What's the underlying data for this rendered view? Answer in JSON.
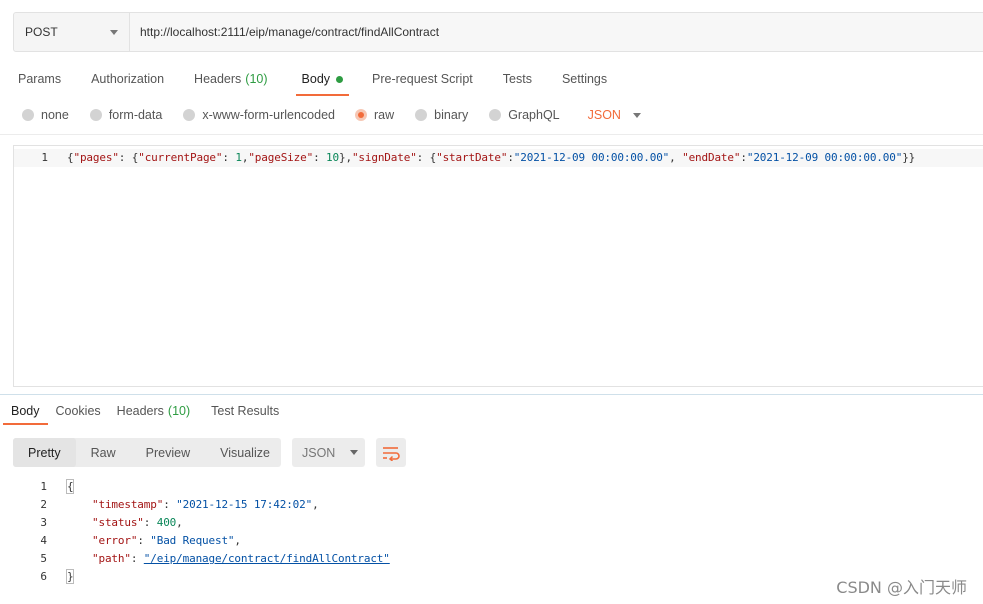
{
  "request": {
    "method": "POST",
    "url": "http://localhost:2111/eip/manage/contract/findAllContract"
  },
  "request_tabs": [
    {
      "label": "Params"
    },
    {
      "label": "Authorization"
    },
    {
      "label": "Headers",
      "count": "(10)"
    },
    {
      "label": "Body",
      "active": true
    },
    {
      "label": "Pre-request Script"
    },
    {
      "label": "Tests"
    },
    {
      "label": "Settings"
    }
  ],
  "body_types": [
    {
      "label": "none"
    },
    {
      "label": "form-data"
    },
    {
      "label": "x-www-form-urlencoded"
    },
    {
      "label": "raw",
      "selected": true
    },
    {
      "label": "binary"
    },
    {
      "label": "GraphQL"
    }
  ],
  "body_language": "JSON",
  "request_body": {
    "line_number": "1",
    "text": "{\"pages\": {\"currentPage\": 1,\"pageSize\": 10},\"signDate\": {\"startDate\":\"2021-12-09 00:00:00.00\", \"endDate\":\"2021-12-09 00:00:00.00\"}}"
  },
  "response_tabs": [
    {
      "label": "Body",
      "active": true
    },
    {
      "label": "Cookies"
    },
    {
      "label": "Headers",
      "count": "(10)"
    },
    {
      "label": "Test Results"
    }
  ],
  "response_view": {
    "options": [
      "Pretty",
      "Raw",
      "Preview",
      "Visualize"
    ],
    "active": "Pretty",
    "format": "JSON",
    "wrap_icon": "wrap-lines-icon"
  },
  "response_body": {
    "line_numbers": [
      "1",
      "2",
      "3",
      "4",
      "5",
      "6"
    ],
    "open_brace": "{",
    "close_brace": "}",
    "fields": [
      {
        "key": "\"timestamp\"",
        "value": "\"2021-12-15 17:42:02\"",
        "type": "string"
      },
      {
        "key": "\"status\"",
        "value": "400",
        "type": "number"
      },
      {
        "key": "\"error\"",
        "value": "\"Bad Request\"",
        "type": "string"
      },
      {
        "key": "\"path\"",
        "value": "\"/eip/manage/contract/findAllContract\"",
        "type": "link"
      }
    ]
  },
  "watermark": "CSDN @入门天师",
  "colors": {
    "accent": "#f26b3a",
    "count_green": "#2e9c42",
    "json_key": "#a31515",
    "json_string": "#0451a5",
    "json_number": "#098658"
  }
}
